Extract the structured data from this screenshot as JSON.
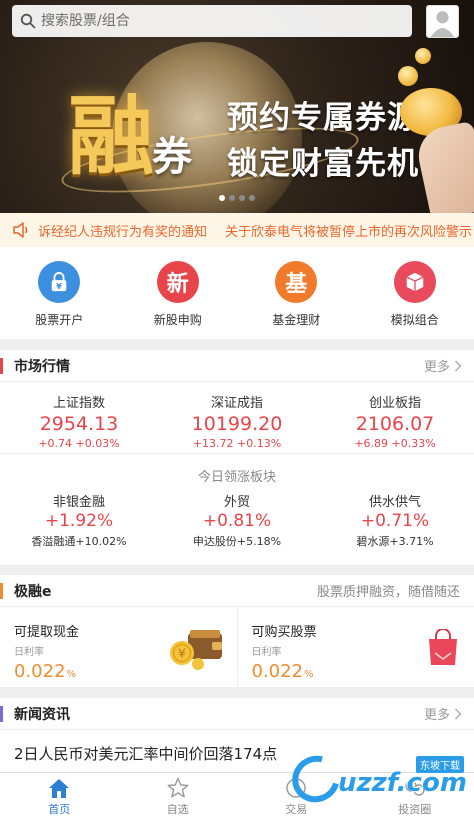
{
  "search": {
    "placeholder": "搜索股票/组合"
  },
  "banner": {
    "big_char": "融",
    "small_char": "券",
    "slogan_line1": "预约专属券源",
    "slogan_line2": "锁定财富先机",
    "page_count": 4,
    "active_page": 1
  },
  "notice": {
    "item1": "诉经纪人违规行为有奖的通知",
    "item2": "关于欣泰电气将被暂停上市的再次风险警示"
  },
  "actions": [
    {
      "label": "股票开户",
      "icon": "lock-icon",
      "glyph": "¥",
      "color": "#3d8fe0"
    },
    {
      "label": "新股申购",
      "icon": "new-icon",
      "glyph": "新",
      "color": "#e8454a"
    },
    {
      "label": "基金理财",
      "icon": "fund-icon",
      "glyph": "基",
      "color": "#f07a2a"
    },
    {
      "label": "模拟组合",
      "icon": "box-icon",
      "glyph": "",
      "color": "#e94a5c"
    }
  ],
  "market": {
    "title": "市场行情",
    "more": "更多",
    "accent": "#e8454a",
    "indices": [
      {
        "name": "上证指数",
        "value": "2954.13",
        "change": "+0.74  +0.03%"
      },
      {
        "name": "深证成指",
        "value": "10199.20",
        "change": "+13.72  +0.13%"
      },
      {
        "name": "创业板指",
        "value": "2106.07",
        "change": "+6.89  +0.33%"
      }
    ],
    "sector_label": "今日领涨板块",
    "sectors": [
      {
        "name": "非银金融",
        "pct": "+1.92%",
        "lead": "香溢融通+10.02%"
      },
      {
        "name": "外贸",
        "pct": "+0.81%",
        "lead": "申达股份+5.18%"
      },
      {
        "name": "供水供气",
        "pct": "+0.71%",
        "lead": "碧水源+3.71%"
      }
    ]
  },
  "rongzi": {
    "title": "极融e",
    "subtitle": "股票质押融资，随借随还",
    "accent": "#f08c2e",
    "items": [
      {
        "title": "可提取现金",
        "sub": "日利率",
        "rate": "0.022",
        "unit": "%"
      },
      {
        "title": "可购买股票",
        "sub": "日利率",
        "rate": "0.022",
        "unit": "%"
      }
    ]
  },
  "news": {
    "title": "新闻资讯",
    "more": "更多",
    "accent": "#7b6bd6",
    "items": [
      "2日人民币对美元汇率中间价回落174点"
    ]
  },
  "tabs": [
    {
      "label": "首页",
      "icon": "home-icon",
      "active": true
    },
    {
      "label": "自选",
      "icon": "star-icon",
      "active": false
    },
    {
      "label": "交易",
      "icon": "trade-icon",
      "active": false
    },
    {
      "label": "投资圈",
      "icon": "circle-icon",
      "active": false
    }
  ],
  "watermark": {
    "text": "uzzf.com",
    "badge": "东坡下载"
  }
}
